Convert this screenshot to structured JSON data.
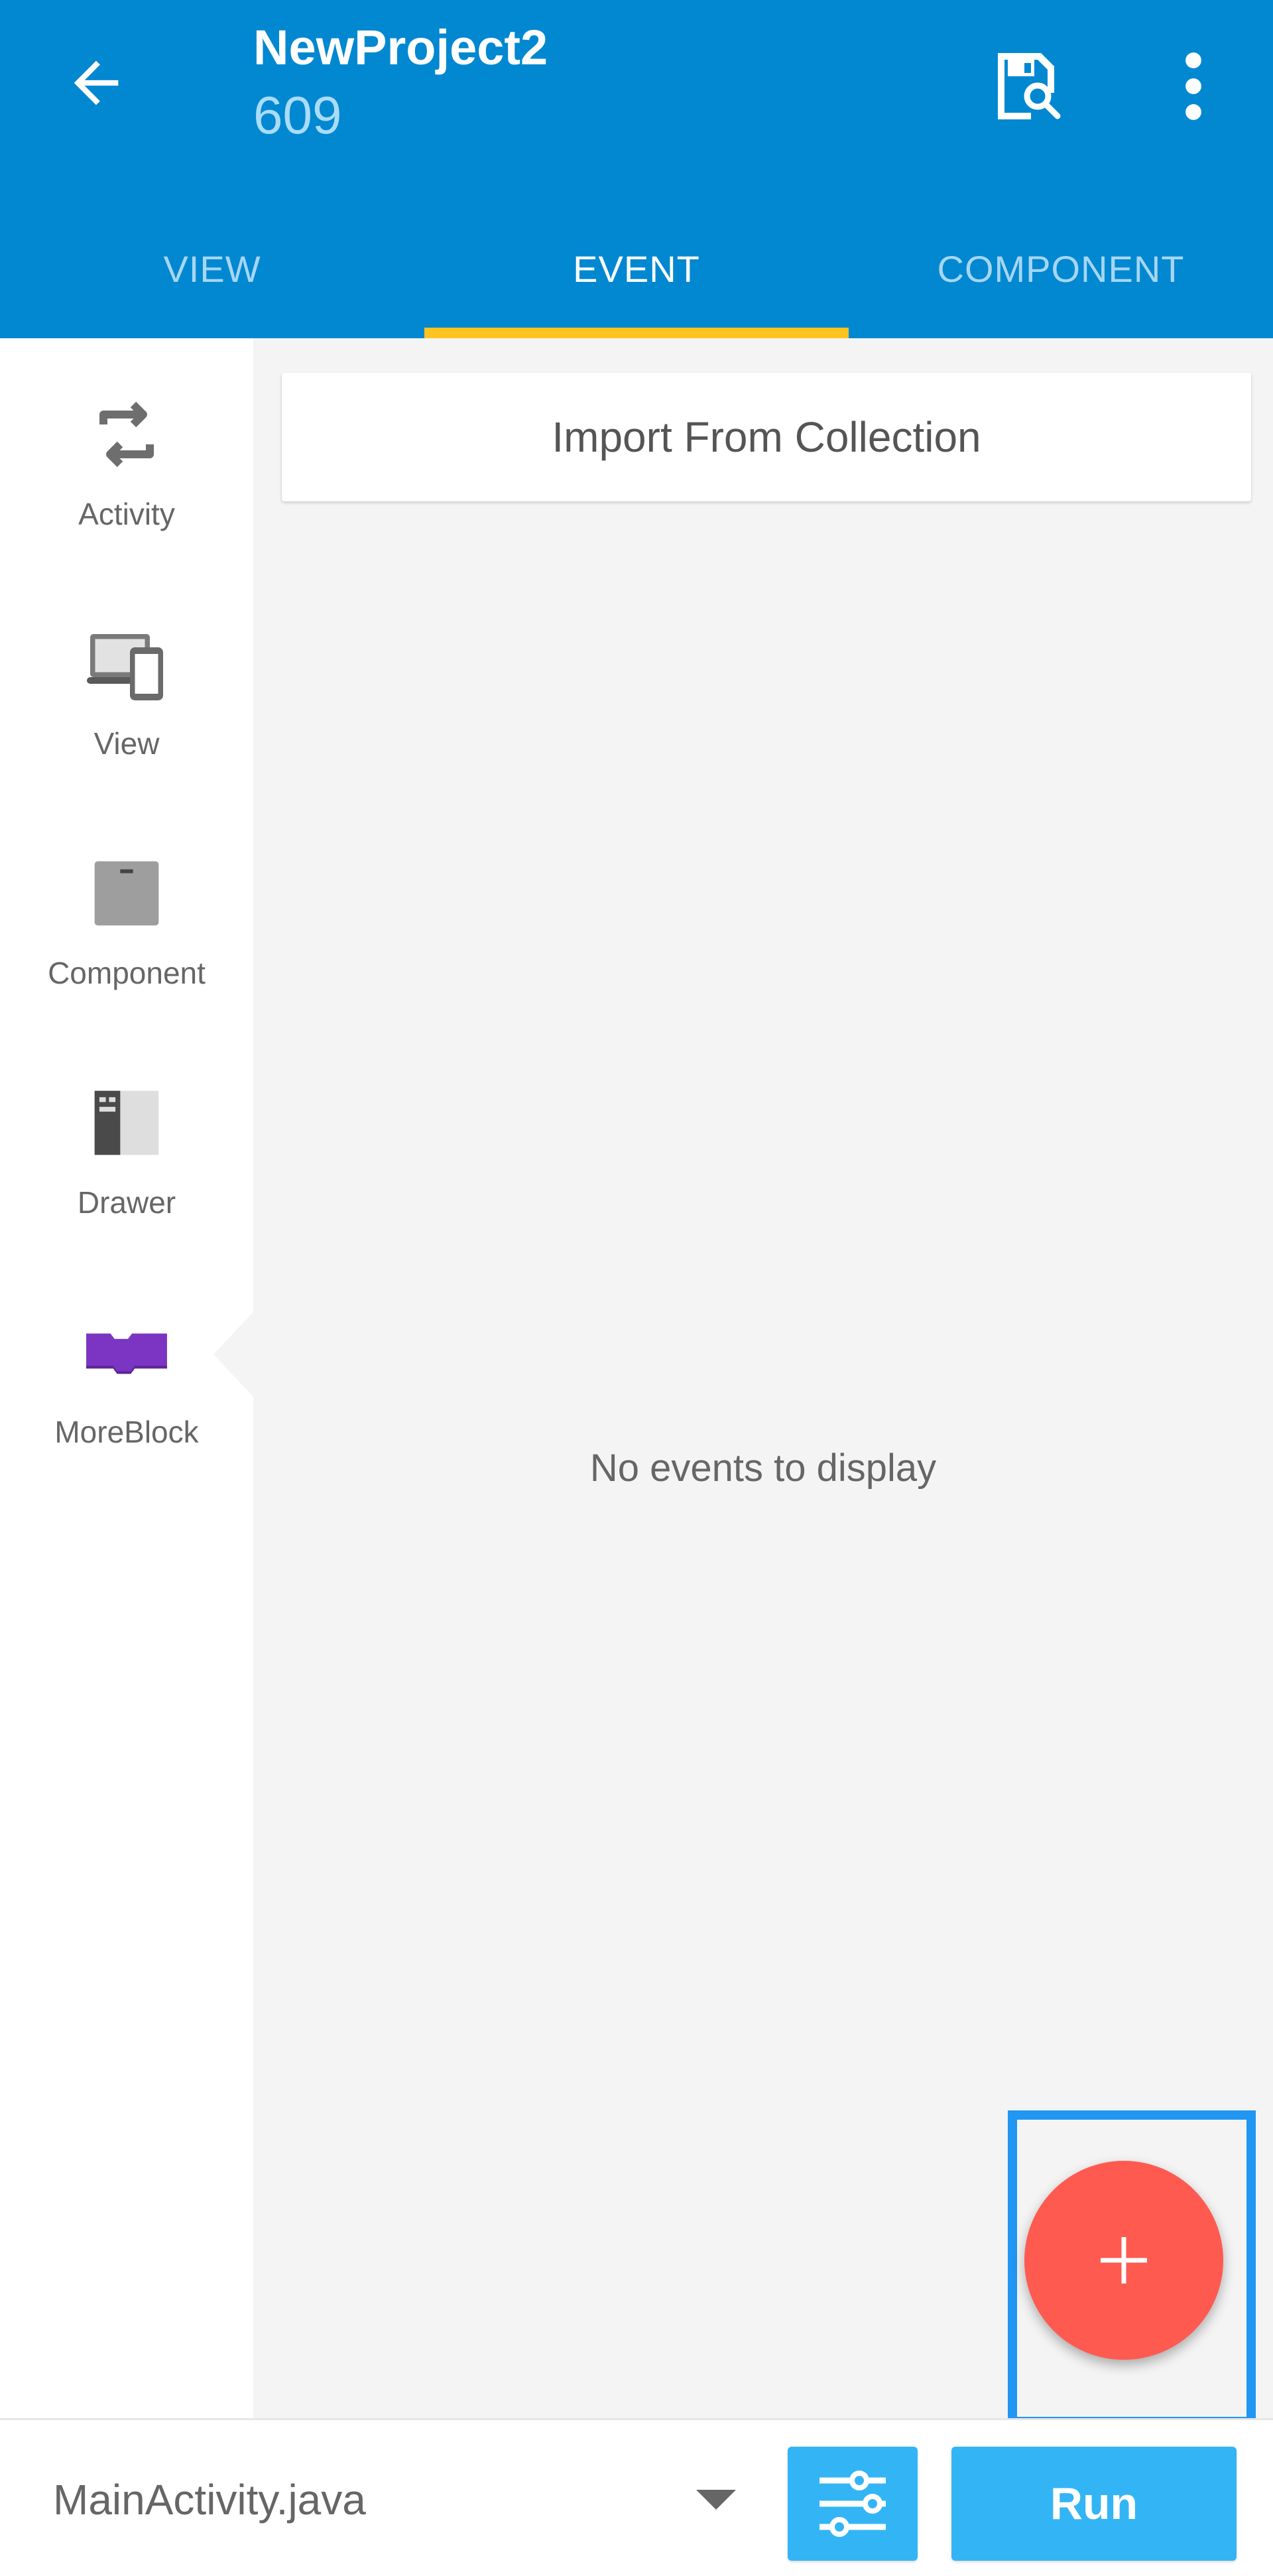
{
  "app_bar": {
    "project_name": "NewProject2",
    "project_id": "609",
    "back_icon": "arrow-left-icon",
    "save_icon": "save-search-icon",
    "more_icon": "more-vertical-icon"
  },
  "tabs": [
    {
      "label": "VIEW",
      "active": false
    },
    {
      "label": "EVENT",
      "active": true
    },
    {
      "label": "COMPONENT",
      "active": false
    }
  ],
  "palette": {
    "items": [
      {
        "label": "Activity",
        "icon": "activity-cycle-icon"
      },
      {
        "label": "View",
        "icon": "devices-icon"
      },
      {
        "label": "Component",
        "icon": "component-box-icon"
      },
      {
        "label": "Drawer",
        "icon": "drawer-icon"
      },
      {
        "label": "MoreBlock",
        "icon": "moreblock-icon",
        "selected": true
      }
    ]
  },
  "main": {
    "import_label": "Import From Collection",
    "empty_message": "No events to display"
  },
  "fab": {
    "icon": "plus-icon",
    "symbol": "+"
  },
  "bottom_bar": {
    "file_name": "MainActivity.java",
    "dropdown_icon": "caret-down-icon",
    "settings_icon": "tune-sliders-icon",
    "run_label": "Run"
  },
  "colors": {
    "primary": "#0288d1",
    "tab_indicator": "#ffc31f",
    "fab": "#ff5a50",
    "accent_button": "#33b5f5",
    "moreblock": "#7b35c2",
    "highlight": "#2196f3"
  }
}
